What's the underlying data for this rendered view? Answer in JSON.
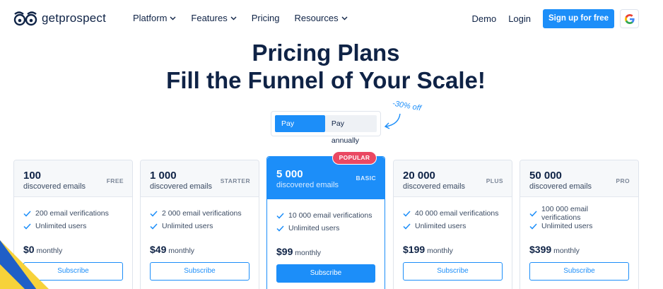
{
  "brand": {
    "name": "getprospect"
  },
  "nav": {
    "menu": [
      {
        "label": "Platform",
        "dropdown": true
      },
      {
        "label": "Features",
        "dropdown": true
      },
      {
        "label": "Pricing",
        "dropdown": false
      },
      {
        "label": "Resources",
        "dropdown": true
      }
    ],
    "demo": "Demo",
    "login": "Login",
    "signup": "Sign up for free",
    "google_icon": "google-icon"
  },
  "hero": {
    "line1": "Pricing Plans",
    "line2": "Fill the Funnel of Your Scale!"
  },
  "billing": {
    "monthly": "Pay monthly",
    "annually": "Pay annually",
    "selected": "Pay monthly",
    "discount": "-30% off"
  },
  "popular_badge": "POPULAR",
  "plans": [
    {
      "count": "100",
      "sub": "discovered emails",
      "tier": "FREE",
      "features": [
        "200 email verifications",
        "Unlimited users"
      ],
      "price": "$0",
      "period": "monthly",
      "cta": "Subscribe"
    },
    {
      "count": "1 000",
      "sub": "discovered emails",
      "tier": "STARTER",
      "features": [
        "2 000 email verifications",
        "Unlimited users"
      ],
      "price": "$49",
      "period": "monthly",
      "cta": "Subscribe"
    },
    {
      "count": "5 000",
      "sub": "discovered emails",
      "tier": "BASIC",
      "features": [
        "10 000 email verifications",
        "Unlimited users"
      ],
      "price": "$99",
      "period": "monthly",
      "cta": "Subscribe"
    },
    {
      "count": "20 000",
      "sub": "discovered emails",
      "tier": "PLUS",
      "features": [
        "40 000 email verifications",
        "Unlimited users"
      ],
      "price": "$199",
      "period": "monthly",
      "cta": "Subscribe"
    },
    {
      "count": "50 000",
      "sub": "discovered emails",
      "tier": "PRO",
      "features": [
        "100 000 email verifications",
        "Unlimited users"
      ],
      "price": "$399",
      "period": "monthly",
      "cta": "Subscribe"
    }
  ],
  "colors": {
    "accent": "#1c8ef9",
    "navy": "#0f2346",
    "badge": "#ea4862",
    "flag_blue": "#1f5fc7",
    "flag_yellow": "#f7d23a"
  }
}
